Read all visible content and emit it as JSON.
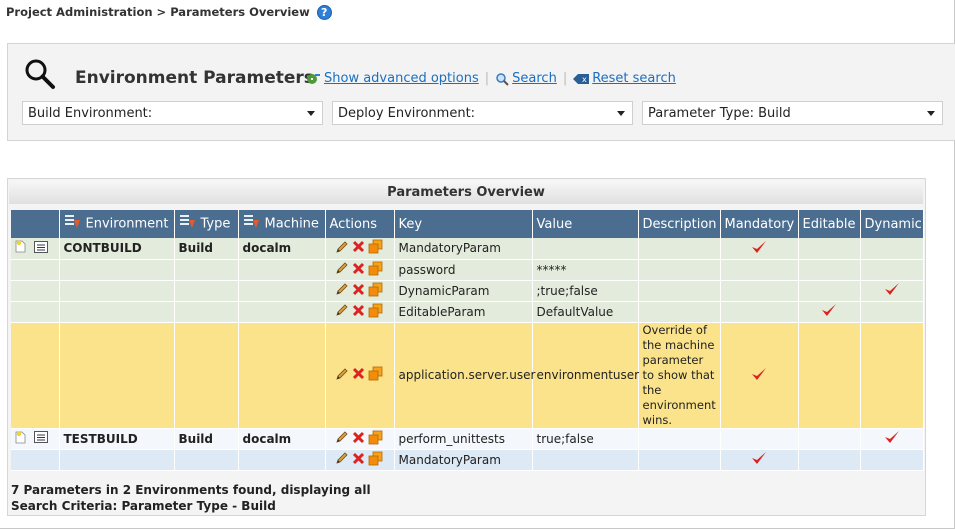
{
  "breadcrumb": "Project Administration > Parameters Overview",
  "search": {
    "title": "Environment Parameters",
    "links": {
      "advanced": "Show advanced options",
      "search": "Search",
      "reset": "Reset search"
    },
    "dropdowns": {
      "build": "Build Environment:",
      "deploy": "Deploy Environment:",
      "type": "Parameter Type: Build"
    }
  },
  "overview": {
    "title": "Parameters Overview",
    "columns": [
      "Environment",
      "Type",
      "Machine",
      "Actions",
      "Key",
      "Value",
      "Description",
      "Mandatory",
      "Editable",
      "Dynamic"
    ],
    "rows": [
      {
        "environment": "CONTBUILD",
        "type": "Build",
        "machine": "docalm",
        "key": "MandatoryParam",
        "value": "",
        "description": "",
        "mandatory": true,
        "editable": false,
        "dynamic": false
      },
      {
        "environment": "",
        "type": "",
        "machine": "",
        "key": "password",
        "value": "*****",
        "description": "",
        "mandatory": false,
        "editable": false,
        "dynamic": false
      },
      {
        "environment": "",
        "type": "",
        "machine": "",
        "key": "DynamicParam",
        "value": ";true;false",
        "description": "",
        "mandatory": false,
        "editable": false,
        "dynamic": true
      },
      {
        "environment": "",
        "type": "",
        "machine": "",
        "key": "EditableParam",
        "value": "DefaultValue",
        "description": "",
        "mandatory": false,
        "editable": true,
        "dynamic": false
      },
      {
        "environment": "",
        "type": "",
        "machine": "",
        "key": "application.server.user",
        "value": "environmentuser",
        "description": "Override of the machine parameter to show that the environment wins.",
        "mandatory": true,
        "editable": false,
        "dynamic": false
      },
      {
        "environment": "TESTBUILD",
        "type": "Build",
        "machine": "docalm",
        "key": "perform_unittests",
        "value": "true;false",
        "description": "",
        "mandatory": false,
        "editable": false,
        "dynamic": true
      },
      {
        "environment": "",
        "type": "",
        "machine": "",
        "key": "MandatoryParam",
        "value": "",
        "description": "",
        "mandatory": true,
        "editable": false,
        "dynamic": false
      }
    ]
  },
  "footer": {
    "summary": "7 Parameters in 2 Environments found, displaying all",
    "criteria": "Search Criteria: Parameter Type - Build"
  },
  "colors": {
    "header": "#4a6d90",
    "group_row": "#e3ecdc",
    "highlight_row": "#fbe38c",
    "link": "#1a6fc0",
    "check": "#e0201e"
  }
}
